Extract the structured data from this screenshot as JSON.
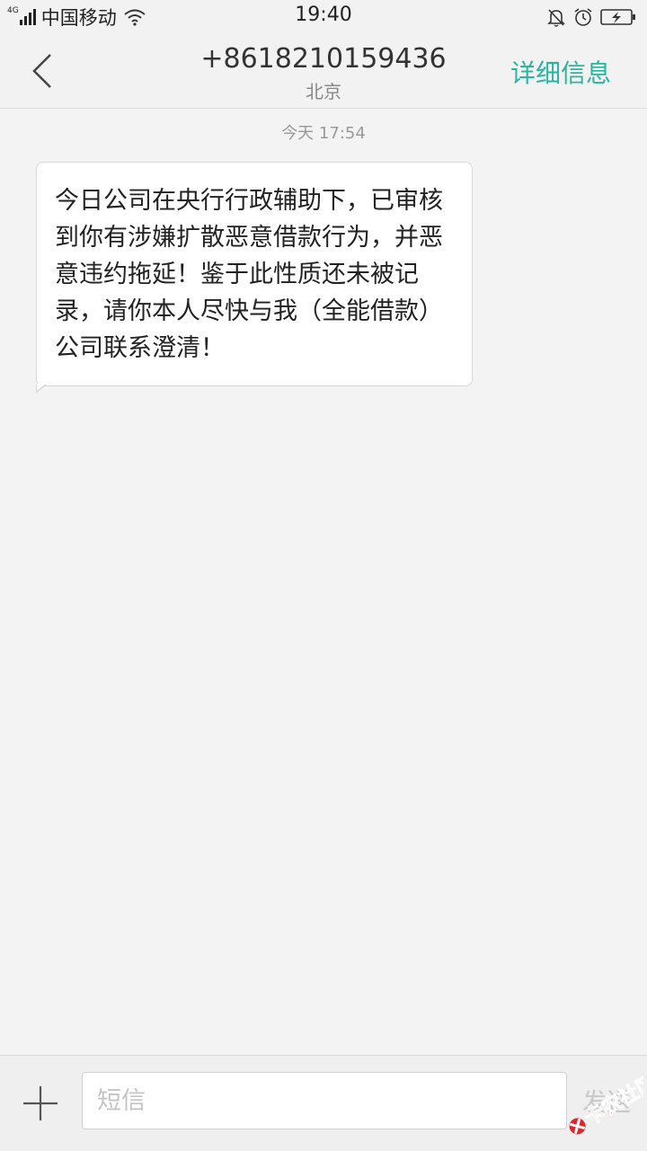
{
  "status_bar": {
    "network_type": "4G",
    "carrier": "中国移动",
    "time": "19:40",
    "icons": [
      "signal-icon",
      "wifi-icon",
      "mute-bell-icon",
      "alarm-icon",
      "battery-charging-icon"
    ]
  },
  "header": {
    "contact_number": "+8618210159436",
    "contact_location": "北京",
    "details_label": "详细信息",
    "accent_color": "#2bb5a0"
  },
  "conversation": {
    "timestamp": "今天  17:54",
    "messages": [
      {
        "direction": "incoming",
        "text": "今日公司在央行行政辅助下，已审核到你有涉嫌扩散恶意借款行为，并恶意违约拖延！鉴于此性质还未被记录，请你本人尽快与我（全能借款）公司联系澄清！"
      }
    ]
  },
  "input_bar": {
    "placeholder": "短信",
    "value": "",
    "send_label": "发送"
  },
  "watermark": {
    "text": "卡农社区"
  }
}
